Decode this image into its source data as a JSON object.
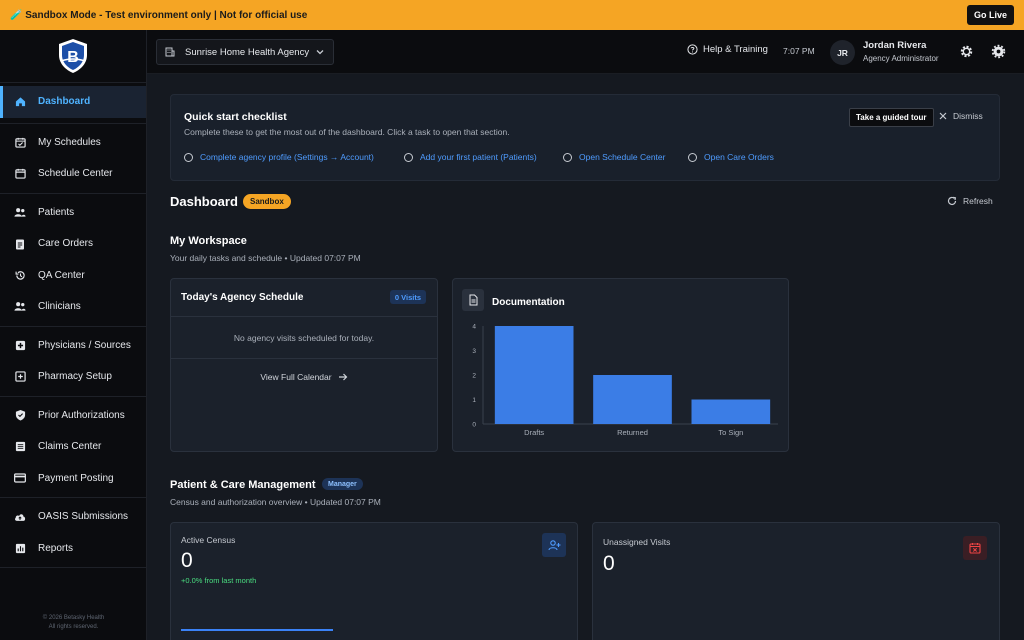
{
  "banner": {
    "text": "🧪 Sandbox Mode - Test environment only | Not for official use",
    "go_live": "Go Live"
  },
  "sidebar": {
    "groups": [
      [
        {
          "label": "Dashboard",
          "icon": "home-icon",
          "active": true
        }
      ],
      [
        {
          "label": "My Schedules",
          "icon": "calendar-check-icon"
        },
        {
          "label": "Schedule Center",
          "icon": "calendar-icon"
        }
      ],
      [
        {
          "label": "Patients",
          "icon": "users-icon"
        },
        {
          "label": "Care Orders",
          "icon": "clipboard-icon"
        },
        {
          "label": "QA Center",
          "icon": "history-icon"
        },
        {
          "label": "Clinicians",
          "icon": "team-icon"
        }
      ],
      [
        {
          "label": "Physicians / Sources",
          "icon": "medical-plus-icon"
        },
        {
          "label": "Pharmacy Setup",
          "icon": "pharmacy-icon"
        }
      ],
      [
        {
          "label": "Prior Authorizations",
          "icon": "shield-check-icon"
        },
        {
          "label": "Claims Center",
          "icon": "list-icon"
        },
        {
          "label": "Payment Posting",
          "icon": "credit-card-icon"
        }
      ],
      [
        {
          "label": "OASIS Submissions",
          "icon": "cloud-upload-icon"
        },
        {
          "label": "Reports",
          "icon": "bar-chart-icon"
        }
      ]
    ],
    "copyright_line1": "© 2026 Betasky Health",
    "copyright_line2": "All rights reserved."
  },
  "topbar": {
    "agency": "Sunrise Home Health Agency",
    "help": "Help & Training",
    "time": "7:07 PM",
    "avatar": "JR",
    "user_name": "Jordan Rivera",
    "user_role": "Agency Administrator"
  },
  "checklist": {
    "title": "Quick start checklist",
    "subtitle": "Complete these to get the most out of the dashboard. Click a task to open that section.",
    "tour": "Take a guided tour",
    "dismiss": "Dismiss",
    "tasks": [
      "Complete agency profile (Settings → Account)",
      "Add your first patient (Patients)",
      "Open Schedule Center",
      "Open Care Orders"
    ]
  },
  "dashboard": {
    "title": "Dashboard",
    "badge": "Sandbox",
    "refresh": "Refresh"
  },
  "workspace": {
    "title": "My Workspace",
    "subtitle": "Your daily tasks and schedule • Updated 07:07 PM",
    "schedule": {
      "title": "Today's Agency Schedule",
      "badge": "0 Visits",
      "empty": "No agency visits scheduled for today.",
      "view_calendar": "View Full Calendar"
    },
    "documentation": {
      "title": "Documentation"
    }
  },
  "chart_data": {
    "type": "bar",
    "title": "Documentation",
    "categories": [
      "Drafts",
      "Returned",
      "To Sign"
    ],
    "values": [
      4,
      2,
      1
    ],
    "ylim": [
      0,
      4
    ],
    "yticks": [
      "0",
      "1",
      "2",
      "3",
      "4"
    ],
    "color": "#3b7de6"
  },
  "patient_care": {
    "title": "Patient & Care Management",
    "badge": "Manager",
    "subtitle": "Census and authorization overview • Updated 07:07 PM",
    "census": {
      "label": "Active Census",
      "value": "0",
      "change": "+0.0% from last month"
    },
    "unassigned": {
      "label": "Unassigned Visits",
      "value": "0"
    }
  }
}
